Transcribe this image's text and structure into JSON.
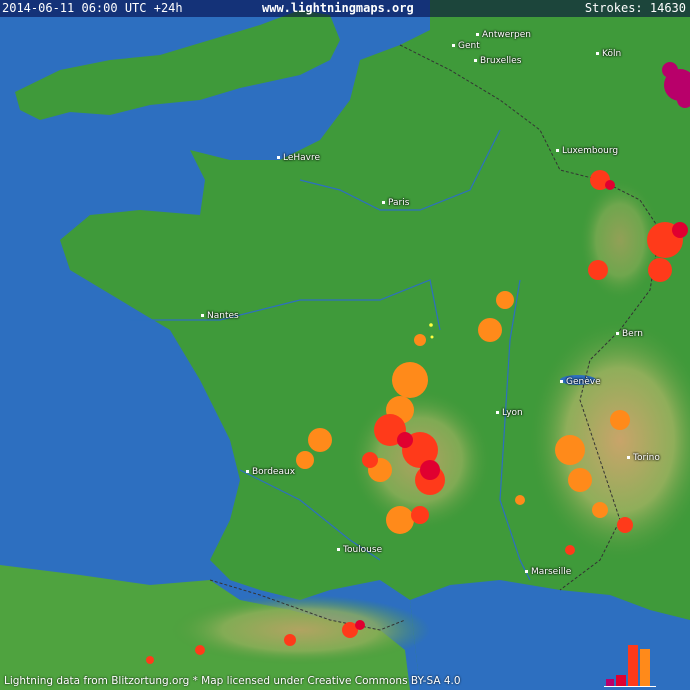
{
  "header": {
    "time": "2014-06-11 06:00 UTC +24h",
    "site": "www.lightningmaps.org",
    "strokes_label": "Strokes:",
    "strokes_value": "14630"
  },
  "cities": [
    "Gent",
    "Antwerpen",
    "Bruxelles",
    "Köln",
    "LeHavre",
    "Paris",
    "Luxembourg",
    "Nantes",
    "Bern",
    "Genève",
    "Lyon",
    "Torino",
    "Bordeaux",
    "Toulouse",
    "Marseille"
  ],
  "footer": {
    "attribution": "Lightning data from Blitzortung.org  *  Map licensed under Creative Commons BY-SA 4.0"
  },
  "colors": {
    "sea": "#2d6fc0",
    "land": "#3f9a3a",
    "strike_recent": "#b8006a",
    "strike_red": "#e00030",
    "strike_orange_red": "#ff3a1a",
    "strike_orange": "#ff8a1a"
  }
}
